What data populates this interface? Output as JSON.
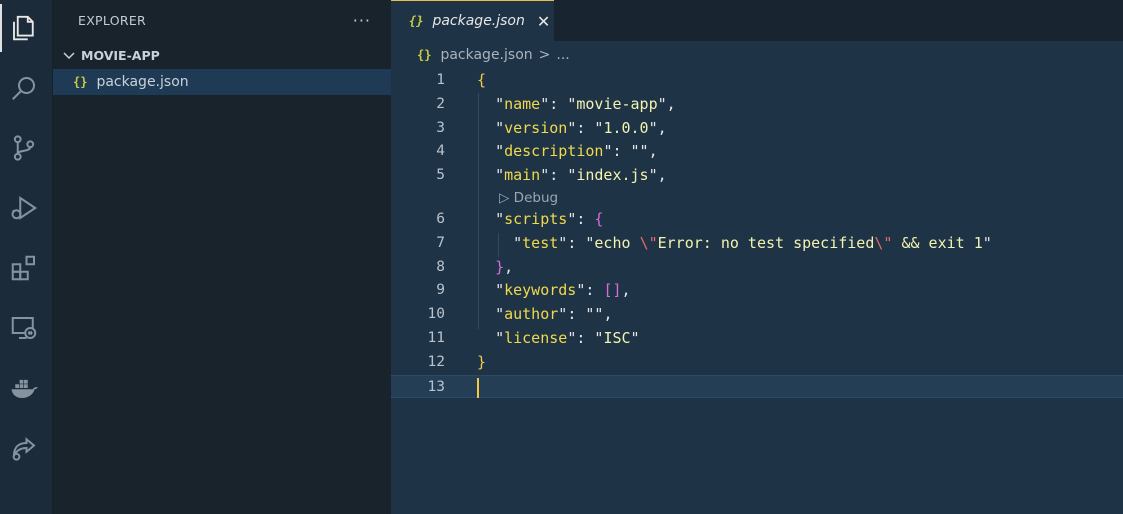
{
  "activity_bar": {
    "icons": [
      "explorer-icon",
      "search-icon",
      "source-control-icon",
      "run-debug-icon",
      "extensions-icon",
      "remote-explorer-icon",
      "docker-icon",
      "live-share-icon"
    ]
  },
  "sidebar": {
    "title": "EXPLORER",
    "more_label": "···",
    "folder": "MOVIE-APP",
    "files": [
      {
        "name": "package.json",
        "icon": "{}"
      }
    ]
  },
  "editor": {
    "tab": {
      "icon": "{}",
      "label": "package.json",
      "close": "✕"
    },
    "breadcrumb": {
      "icon": "{}",
      "file": "package.json",
      "sep": ">",
      "rest": "..."
    },
    "code_lens": "▷ Debug",
    "line_numbers": [
      "1",
      "2",
      "3",
      "4",
      "5",
      "6",
      "7",
      "8",
      "9",
      "10",
      "11",
      "12",
      "13"
    ],
    "lines": [
      "{",
      "  \"name\": \"movie-app\",",
      "  \"version\": \"1.0.0\",",
      "  \"description\": \"\",",
      "  \"main\": \"index.js\",",
      "  \"scripts\": {",
      "    \"test\": \"echo \\\"Error: no test specified\\\" && exit 1\"",
      "  },",
      "  \"keywords\": [],",
      "  \"author\": \"\",",
      "  \"license\": \"ISC\"",
      "}",
      ""
    ]
  },
  "colors": {
    "accent_tab_border": "#e8bd4a",
    "json_key": "#f0d94c",
    "brace": "#f2c94c",
    "nested_brace": "#d86cd8",
    "escape": "#e36a6a"
  }
}
